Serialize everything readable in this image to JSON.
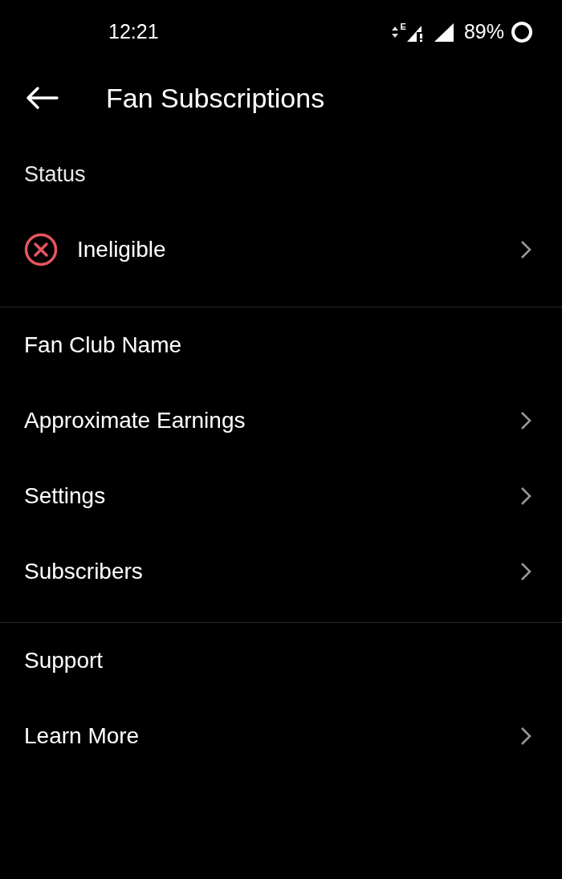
{
  "status_bar": {
    "time": "12:21",
    "network_type": "E",
    "battery": "89%"
  },
  "app_bar": {
    "title": "Fan Subscriptions"
  },
  "sections": [
    {
      "items": [
        {
          "kind": "header",
          "label": "Status"
        },
        {
          "kind": "status",
          "label": "Ineligible",
          "chevron": true
        }
      ]
    },
    {
      "items": [
        {
          "kind": "plain",
          "label": "Fan Club Name",
          "chevron": false
        },
        {
          "kind": "plain",
          "label": "Approximate Earnings",
          "chevron": true
        },
        {
          "kind": "plain",
          "label": "Settings",
          "chevron": true
        },
        {
          "kind": "plain",
          "label": "Subscribers",
          "chevron": true
        }
      ]
    },
    {
      "items": [
        {
          "kind": "plain",
          "label": "Support",
          "chevron": false
        },
        {
          "kind": "plain",
          "label": "Learn More",
          "chevron": true
        }
      ]
    }
  ]
}
